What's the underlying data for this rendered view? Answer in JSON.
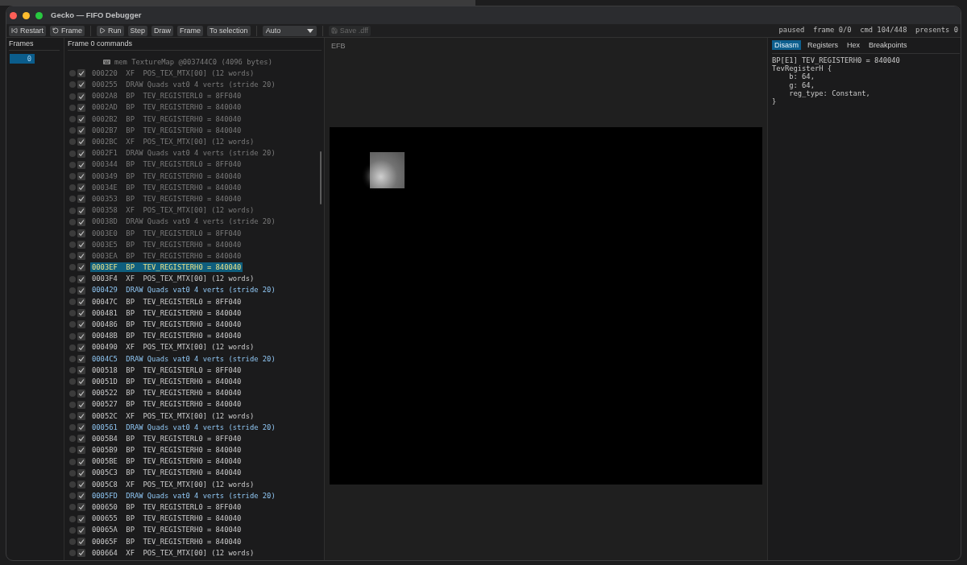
{
  "window": {
    "title": "Gecko — FIFO Debugger"
  },
  "toolbar": {
    "restart": {
      "label": "Restart",
      "disabled": false
    },
    "reload": {
      "label": "Frame",
      "disabled": false
    },
    "run": {
      "label": "Run",
      "disabled": false
    },
    "step": {
      "label": "Step",
      "disabled": false
    },
    "draw": {
      "label": "Draw",
      "disabled": false
    },
    "frame": {
      "label": "Frame",
      "disabled": false
    },
    "to_selection": {
      "label": "To selection",
      "disabled": false
    },
    "mode": {
      "value": "Auto"
    },
    "save": {
      "label": "Save .dff",
      "disabled": true
    }
  },
  "status": [
    "paused",
    "frame 0/0",
    "cmd 104/448",
    "presents 0"
  ],
  "frames_panel": {
    "title": "Frames",
    "items": [
      {
        "label": "0",
        "selected": true
      }
    ]
  },
  "commands_panel": {
    "title": "Frame 0 commands",
    "rows": [
      {
        "kind": "mem",
        "text": "mem TextureMap @003744C0 (4096 bytes)",
        "executed": true
      },
      {
        "kind": "xf",
        "addr": "000220",
        "op": "XF",
        "args": "POS_TEX_MTX[00] (12 words)",
        "breakpoint": false,
        "enabled": true,
        "executed": true,
        "selected": false
      },
      {
        "kind": "draw",
        "addr": "000255",
        "op": "DRAW",
        "args": "Quads vat0 4 verts (stride 20)",
        "breakpoint": false,
        "enabled": true,
        "executed": true,
        "selected": false
      },
      {
        "kind": "bp",
        "addr": "0002A8",
        "op": "BP",
        "args": "TEV_REGISTERL0 = 8FF040",
        "breakpoint": false,
        "enabled": true,
        "executed": true,
        "selected": false
      },
      {
        "kind": "bp",
        "addr": "0002AD",
        "op": "BP",
        "args": "TEV_REGISTERH0 = 840040",
        "breakpoint": false,
        "enabled": true,
        "executed": true,
        "selected": false
      },
      {
        "kind": "bp",
        "addr": "0002B2",
        "op": "BP",
        "args": "TEV_REGISTERH0 = 840040",
        "breakpoint": false,
        "enabled": true,
        "executed": true,
        "selected": false
      },
      {
        "kind": "bp",
        "addr": "0002B7",
        "op": "BP",
        "args": "TEV_REGISTERH0 = 840040",
        "breakpoint": false,
        "enabled": true,
        "executed": true,
        "selected": false
      },
      {
        "kind": "xf",
        "addr": "0002BC",
        "op": "XF",
        "args": "POS_TEX_MTX[00] (12 words)",
        "breakpoint": false,
        "enabled": true,
        "executed": true,
        "selected": false
      },
      {
        "kind": "draw",
        "addr": "0002F1",
        "op": "DRAW",
        "args": "Quads vat0 4 verts (stride 20)",
        "breakpoint": false,
        "enabled": true,
        "executed": true,
        "selected": false
      },
      {
        "kind": "bp",
        "addr": "000344",
        "op": "BP",
        "args": "TEV_REGISTERL0 = 8FF040",
        "breakpoint": false,
        "enabled": true,
        "executed": true,
        "selected": false
      },
      {
        "kind": "bp",
        "addr": "000349",
        "op": "BP",
        "args": "TEV_REGISTERH0 = 840040",
        "breakpoint": false,
        "enabled": true,
        "executed": true,
        "selected": false
      },
      {
        "kind": "bp",
        "addr": "00034E",
        "op": "BP",
        "args": "TEV_REGISTERH0 = 840040",
        "breakpoint": false,
        "enabled": true,
        "executed": true,
        "selected": false
      },
      {
        "kind": "bp",
        "addr": "000353",
        "op": "BP",
        "args": "TEV_REGISTERH0 = 840040",
        "breakpoint": false,
        "enabled": true,
        "executed": true,
        "selected": false
      },
      {
        "kind": "xf",
        "addr": "000358",
        "op": "XF",
        "args": "POS_TEX_MTX[00] (12 words)",
        "breakpoint": false,
        "enabled": true,
        "executed": true,
        "selected": false
      },
      {
        "kind": "draw",
        "addr": "00038D",
        "op": "DRAW",
        "args": "Quads vat0 4 verts (stride 20)",
        "breakpoint": false,
        "enabled": true,
        "executed": true,
        "selected": false
      },
      {
        "kind": "bp",
        "addr": "0003E0",
        "op": "BP",
        "args": "TEV_REGISTERL0 = 8FF040",
        "breakpoint": false,
        "enabled": true,
        "executed": true,
        "selected": false
      },
      {
        "kind": "bp",
        "addr": "0003E5",
        "op": "BP",
        "args": "TEV_REGISTERH0 = 840040",
        "breakpoint": false,
        "enabled": true,
        "executed": true,
        "selected": false
      },
      {
        "kind": "bp",
        "addr": "0003EA",
        "op": "BP",
        "args": "TEV_REGISTERH0 = 840040",
        "breakpoint": false,
        "enabled": true,
        "executed": true,
        "selected": false
      },
      {
        "kind": "bp",
        "addr": "0003EF",
        "op": "BP",
        "args": "TEV_REGISTERH0 = 840040",
        "breakpoint": false,
        "enabled": true,
        "executed": false,
        "selected": true
      },
      {
        "kind": "xf",
        "addr": "0003F4",
        "op": "XF",
        "args": "POS_TEX_MTX[00] (12 words)",
        "breakpoint": false,
        "enabled": true,
        "executed": false,
        "selected": false
      },
      {
        "kind": "draw",
        "addr": "000429",
        "op": "DRAW",
        "args": "Quads vat0 4 verts (stride 20)",
        "breakpoint": false,
        "enabled": true,
        "executed": false,
        "selected": false
      },
      {
        "kind": "bp",
        "addr": "00047C",
        "op": "BP",
        "args": "TEV_REGISTERL0 = 8FF040",
        "breakpoint": false,
        "enabled": true,
        "executed": false,
        "selected": false
      },
      {
        "kind": "bp",
        "addr": "000481",
        "op": "BP",
        "args": "TEV_REGISTERH0 = 840040",
        "breakpoint": false,
        "enabled": true,
        "executed": false,
        "selected": false
      },
      {
        "kind": "bp",
        "addr": "000486",
        "op": "BP",
        "args": "TEV_REGISTERH0 = 840040",
        "breakpoint": false,
        "enabled": true,
        "executed": false,
        "selected": false
      },
      {
        "kind": "bp",
        "addr": "00048B",
        "op": "BP",
        "args": "TEV_REGISTERH0 = 840040",
        "breakpoint": false,
        "enabled": true,
        "executed": false,
        "selected": false
      },
      {
        "kind": "xf",
        "addr": "000490",
        "op": "XF",
        "args": "POS_TEX_MTX[00] (12 words)",
        "breakpoint": false,
        "enabled": true,
        "executed": false,
        "selected": false
      },
      {
        "kind": "draw",
        "addr": "0004C5",
        "op": "DRAW",
        "args": "Quads vat0 4 verts (stride 20)",
        "breakpoint": false,
        "enabled": true,
        "executed": false,
        "selected": false
      },
      {
        "kind": "bp",
        "addr": "000518",
        "op": "BP",
        "args": "TEV_REGISTERL0 = 8FF040",
        "breakpoint": false,
        "enabled": true,
        "executed": false,
        "selected": false
      },
      {
        "kind": "bp",
        "addr": "00051D",
        "op": "BP",
        "args": "TEV_REGISTERH0 = 840040",
        "breakpoint": false,
        "enabled": true,
        "executed": false,
        "selected": false
      },
      {
        "kind": "bp",
        "addr": "000522",
        "op": "BP",
        "args": "TEV_REGISTERH0 = 840040",
        "breakpoint": false,
        "enabled": true,
        "executed": false,
        "selected": false
      },
      {
        "kind": "bp",
        "addr": "000527",
        "op": "BP",
        "args": "TEV_REGISTERH0 = 840040",
        "breakpoint": false,
        "enabled": true,
        "executed": false,
        "selected": false
      },
      {
        "kind": "xf",
        "addr": "00052C",
        "op": "XF",
        "args": "POS_TEX_MTX[00] (12 words)",
        "breakpoint": false,
        "enabled": true,
        "executed": false,
        "selected": false
      },
      {
        "kind": "draw",
        "addr": "000561",
        "op": "DRAW",
        "args": "Quads vat0 4 verts (stride 20)",
        "breakpoint": false,
        "enabled": true,
        "executed": false,
        "selected": false
      },
      {
        "kind": "bp",
        "addr": "0005B4",
        "op": "BP",
        "args": "TEV_REGISTERL0 = 8FF040",
        "breakpoint": false,
        "enabled": true,
        "executed": false,
        "selected": false
      },
      {
        "kind": "bp",
        "addr": "0005B9",
        "op": "BP",
        "args": "TEV_REGISTERH0 = 840040",
        "breakpoint": false,
        "enabled": true,
        "executed": false,
        "selected": false
      },
      {
        "kind": "bp",
        "addr": "0005BE",
        "op": "BP",
        "args": "TEV_REGISTERH0 = 840040",
        "breakpoint": false,
        "enabled": true,
        "executed": false,
        "selected": false
      },
      {
        "kind": "bp",
        "addr": "0005C3",
        "op": "BP",
        "args": "TEV_REGISTERH0 = 840040",
        "breakpoint": false,
        "enabled": true,
        "executed": false,
        "selected": false
      },
      {
        "kind": "xf",
        "addr": "0005C8",
        "op": "XF",
        "args": "POS_TEX_MTX[00] (12 words)",
        "breakpoint": false,
        "enabled": true,
        "executed": false,
        "selected": false
      },
      {
        "kind": "draw",
        "addr": "0005FD",
        "op": "DRAW",
        "args": "Quads vat0 4 verts (stride 20)",
        "breakpoint": false,
        "enabled": true,
        "executed": false,
        "selected": false
      },
      {
        "kind": "bp",
        "addr": "000650",
        "op": "BP",
        "args": "TEV_REGISTERL0 = 8FF040",
        "breakpoint": false,
        "enabled": true,
        "executed": false,
        "selected": false
      },
      {
        "kind": "bp",
        "addr": "000655",
        "op": "BP",
        "args": "TEV_REGISTERH0 = 840040",
        "breakpoint": false,
        "enabled": true,
        "executed": false,
        "selected": false
      },
      {
        "kind": "bp",
        "addr": "00065A",
        "op": "BP",
        "args": "TEV_REGISTERH0 = 840040",
        "breakpoint": false,
        "enabled": true,
        "executed": false,
        "selected": false
      },
      {
        "kind": "bp",
        "addr": "00065F",
        "op": "BP",
        "args": "TEV_REGISTERH0 = 840040",
        "breakpoint": false,
        "enabled": true,
        "executed": false,
        "selected": false
      },
      {
        "kind": "xf",
        "addr": "000664",
        "op": "XF",
        "args": "POS_TEX_MTX[00] (12 words)",
        "breakpoint": false,
        "enabled": true,
        "executed": false,
        "selected": false
      }
    ]
  },
  "efb_panel": {
    "title": "EFB"
  },
  "inspector": {
    "tabs": [
      {
        "label": "Disasm",
        "selected": true
      },
      {
        "label": "Registers",
        "selected": false
      },
      {
        "label": "Hex",
        "selected": false
      },
      {
        "label": "Breakpoints",
        "selected": false
      }
    ],
    "output": {
      "header": "BP[E1] TEV_REGISTERH0 = 840040",
      "block": {
        "open": "TevRegisterH {",
        "children": [
          "b: 64,",
          "g: 64,",
          "reg_type: Constant,"
        ],
        "close": "}"
      }
    }
  }
}
